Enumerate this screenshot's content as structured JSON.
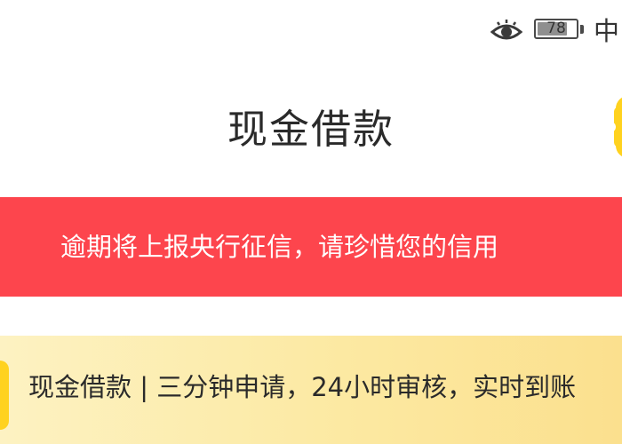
{
  "status_bar": {
    "icon_eye": "eye-icon",
    "battery_level": "78",
    "battery_fraction": 0.78,
    "carrier": "中"
  },
  "header": {
    "title": "现金借款",
    "right_icon": "app-logo-icon"
  },
  "warning_banner": {
    "text": "逾期将上报央行征信，请珍惜您的信用",
    "color": "#fd454d"
  },
  "promo": {
    "text": "现金借款 | 三分钟申请，24小时审核，实时到账",
    "icon": "app-logo-icon",
    "color": "#fce9a2"
  },
  "colors": {
    "accent_yellow": "#ffd21f",
    "banner_red": "#fd454d"
  }
}
